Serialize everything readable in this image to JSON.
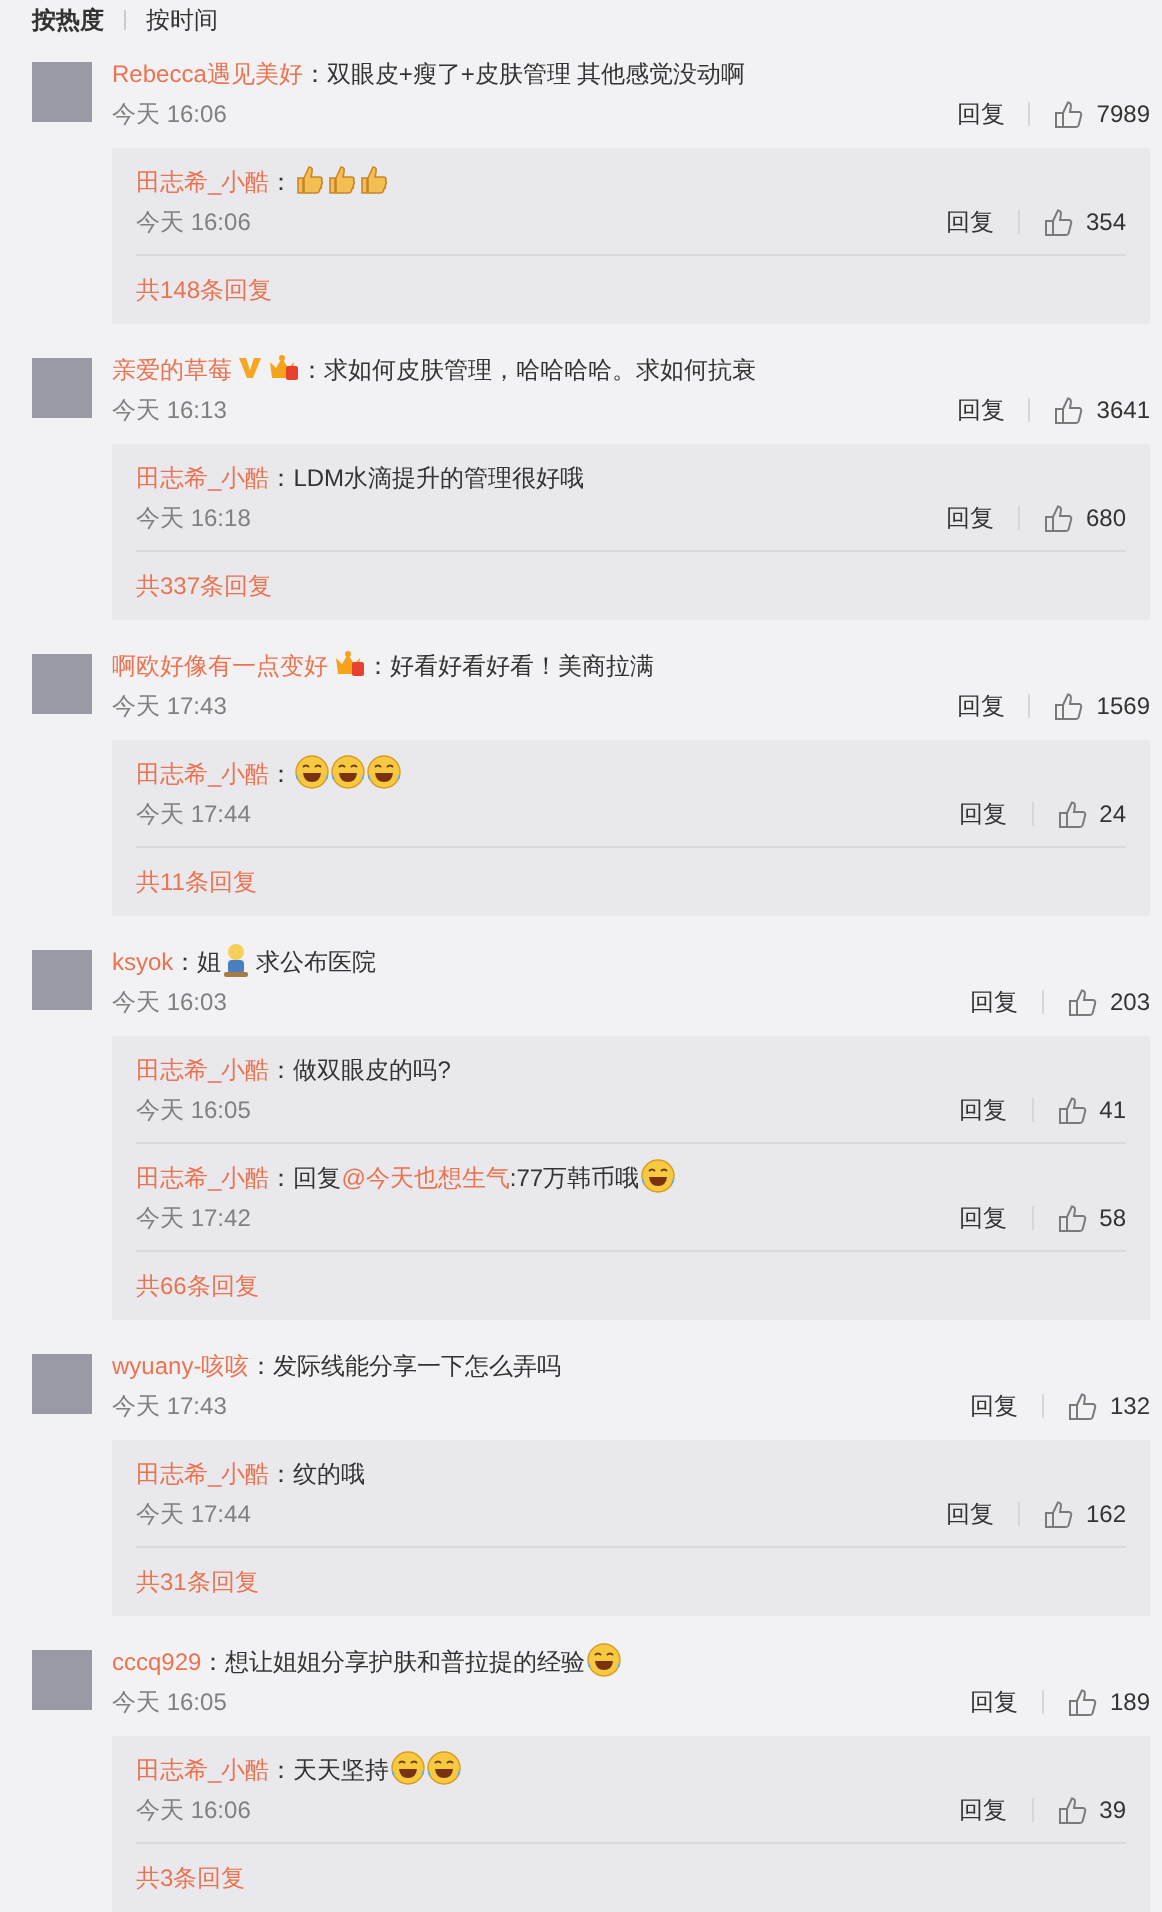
{
  "sort_tabs": [
    {
      "label": "按热度",
      "selected": true
    },
    {
      "label": "按时间",
      "selected": false
    }
  ],
  "comments": [
    {
      "author": "Rebecca遇见美好",
      "content": [
        {
          "kind": "text",
          "text": "：双眼皮+瘦了+皮肤管理 其他感觉没动啊"
        }
      ],
      "time": "今天 16:06",
      "reply_label": "回复",
      "likes": "7989",
      "replies": [
        {
          "author": "田志希_小酷",
          "content": [
            {
              "kind": "text",
              "text": "："
            },
            {
              "kind": "thumbs"
            },
            {
              "kind": "thumbs"
            },
            {
              "kind": "thumbs"
            }
          ],
          "time": "今天 16:06",
          "reply_label": "回复",
          "likes": "354"
        }
      ],
      "more": "共148条回复"
    },
    {
      "author": "亲爱的草莓",
      "badges": [
        {
          "kind": "verified"
        },
        {
          "kind": "member"
        }
      ],
      "content": [
        {
          "kind": "text",
          "text": "：求如何皮肤管理，哈哈哈哈。求如何抗衰"
        }
      ],
      "time": "今天 16:13",
      "reply_label": "回复",
      "likes": "3641",
      "replies": [
        {
          "author": "田志希_小酷",
          "content": [
            {
              "kind": "text",
              "text": "：LDM水滴提升的管理很好哦"
            }
          ],
          "time": "今天 16:18",
          "reply_label": "回复",
          "likes": "680"
        }
      ],
      "more": "共337条回复"
    },
    {
      "author": "啊欧好像有一点变好",
      "badges": [
        {
          "kind": "member"
        }
      ],
      "content": [
        {
          "kind": "text",
          "text": "：好看好看好看！美商拉满"
        }
      ],
      "time": "今天 17:43",
      "reply_label": "回复",
      "likes": "1569",
      "replies": [
        {
          "author": "田志希_小酷",
          "content": [
            {
              "kind": "text",
              "text": "："
            },
            {
              "kind": "laugh"
            },
            {
              "kind": "laugh"
            },
            {
              "kind": "laugh"
            }
          ],
          "time": "今天 17:44",
          "reply_label": "回复",
          "likes": "24"
        }
      ],
      "more": "共11条回复"
    },
    {
      "author": "ksyok",
      "content": [
        {
          "kind": "text",
          "text": "：姐"
        },
        {
          "kind": "figure"
        },
        {
          "kind": "text",
          "text": " 求公布医院"
        }
      ],
      "time": "今天 16:03",
      "reply_label": "回复",
      "likes": "203",
      "replies": [
        {
          "author": "田志希_小酷",
          "content": [
            {
              "kind": "text",
              "text": "：做双眼皮的吗?"
            }
          ],
          "time": "今天 16:05",
          "reply_label": "回复",
          "likes": "41"
        },
        {
          "author": "田志希_小酷",
          "content": [
            {
              "kind": "text",
              "text": "：回复"
            },
            {
              "kind": "mention",
              "text": "@今天也想生气"
            },
            {
              "kind": "text",
              "text": ":77万韩币哦"
            },
            {
              "kind": "laugh"
            }
          ],
          "time": "今天 17:42",
          "reply_label": "回复",
          "likes": "58"
        }
      ],
      "more": "共66条回复"
    },
    {
      "author": "wyuany-咳咳",
      "content": [
        {
          "kind": "text",
          "text": "：发际线能分享一下怎么弄吗"
        }
      ],
      "time": "今天 17:43",
      "reply_label": "回复",
      "likes": "132",
      "replies": [
        {
          "author": "田志希_小酷",
          "content": [
            {
              "kind": "text",
              "text": "：纹的哦"
            }
          ],
          "time": "今天 17:44",
          "reply_label": "回复",
          "likes": "162"
        }
      ],
      "more": "共31条回复"
    },
    {
      "author": "cccq929",
      "content": [
        {
          "kind": "text",
          "text": "：想让姐姐分享护肤和普拉提的经验"
        },
        {
          "kind": "laugh"
        }
      ],
      "time": "今天 16:05",
      "reply_label": "回复",
      "likes": "189",
      "replies": [
        {
          "author": "田志希_小酷",
          "content": [
            {
              "kind": "text",
              "text": "：天天坚持"
            },
            {
              "kind": "laugh"
            },
            {
              "kind": "laugh"
            }
          ],
          "time": "今天 16:06",
          "reply_label": "回复",
          "likes": "39"
        }
      ],
      "more": "共3条回复"
    }
  ]
}
